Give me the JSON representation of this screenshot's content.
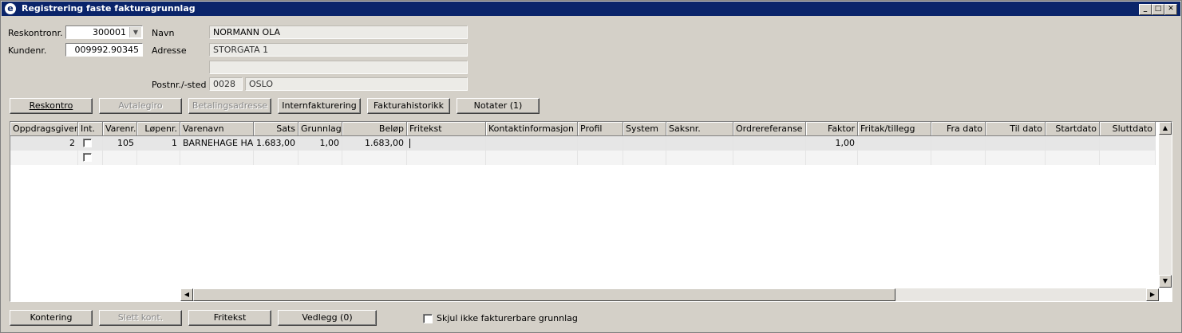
{
  "window": {
    "title": "Registrering faste fakturagrunnlag",
    "app_icon": "e"
  },
  "form": {
    "reskontro_label": "Reskontronr.",
    "reskontro_value": "300001",
    "kunde_label": "Kundenr.",
    "kunde_value": "009992.90345",
    "navn_label": "Navn",
    "navn_value": "NORMANN OLA",
    "adresse_label": "Adresse",
    "adresse1_value": "STORGATA 1",
    "adresse2_value": "",
    "postnr_label": "Postnr./-sted",
    "postnr_value": "0028",
    "poststed_value": "OSLO"
  },
  "top_buttons": {
    "reskontro": "Reskontro",
    "avtalegiro": "Avtalegiro",
    "betalingsadresse": "Betalingsadresse",
    "internfakturering": "Internfakturering",
    "fakturahistorikk": "Fakturahistorikk",
    "notater": "Notater (1)"
  },
  "table": {
    "columns": [
      "Oppdragsgiver",
      "Int.",
      "Varenr.",
      "Løpenr.",
      "Varenavn",
      "Sats",
      "Grunnlag",
      "Beløp",
      "Fritekst",
      "Kontaktinformasjon",
      "Profil",
      "System",
      "Saksnr.",
      "Ordrereferanse",
      "Faktor",
      "Fritak/tillegg",
      "Fra dato",
      "Til dato",
      "Startdato",
      "Sluttdato"
    ],
    "rows": [
      {
        "oppdragsgiver": "2",
        "int": false,
        "varenr": "105",
        "lopenr": "1",
        "varenavn": "BARNEHAGE HALV",
        "sats": "1.683,00",
        "grunnlag": "1,00",
        "belop": "1.683,00",
        "fritekst": "",
        "faktor": "1,00"
      }
    ]
  },
  "bottom_buttons": {
    "kontering": "Kontering",
    "slett_kont": "Slett kont.",
    "fritekst": "Fritekst",
    "vedlegg": "Vedlegg (0)"
  },
  "skjul_label": "Skjul ikke fakturerbare grunnlag",
  "skjul_checked": false
}
